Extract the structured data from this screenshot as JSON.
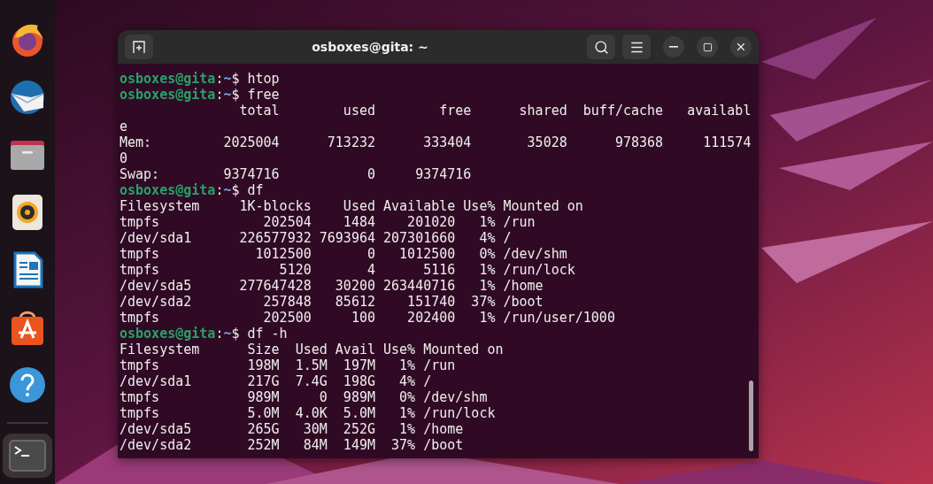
{
  "dock": {
    "items": [
      {
        "kind": "browser",
        "selected": false
      },
      {
        "kind": "mail",
        "selected": false
      },
      {
        "kind": "files",
        "selected": false
      },
      {
        "kind": "music",
        "selected": false
      },
      {
        "kind": "writer",
        "selected": false
      },
      {
        "kind": "store",
        "selected": false
      },
      {
        "kind": "help",
        "selected": false
      },
      {
        "kind": "separator"
      },
      {
        "kind": "terminal",
        "selected": true
      }
    ]
  },
  "window": {
    "title": "osboxes@gita: ~"
  },
  "terminal": {
    "lines": [
      {
        "kind": "prompt",
        "user": "osboxes@gita",
        "separator": ":",
        "path": "~",
        "symbol": "$ ",
        "command": "htop"
      },
      {
        "kind": "prompt",
        "user": "osboxes@gita",
        "separator": ":",
        "path": "~",
        "symbol": "$ ",
        "command": "free"
      },
      {
        "kind": "output",
        "text": "               total        used        free      shared  buff/cache   availabl"
      },
      {
        "kind": "output",
        "text": "e"
      },
      {
        "kind": "output",
        "text": "Mem:         2025004      713232      333404       35028      978368     111574"
      },
      {
        "kind": "output",
        "text": "0"
      },
      {
        "kind": "output",
        "text": "Swap:        9374716           0     9374716"
      },
      {
        "kind": "prompt",
        "user": "osboxes@gita",
        "separator": ":",
        "path": "~",
        "symbol": "$ ",
        "command": "df"
      },
      {
        "kind": "output",
        "text": "Filesystem     1K-blocks    Used Available Use% Mounted on"
      },
      {
        "kind": "output",
        "text": "tmpfs             202504    1484    201020   1% /run"
      },
      {
        "kind": "output",
        "text": "/dev/sda1      226577932 7693964 207301660   4% /"
      },
      {
        "kind": "output",
        "text": "tmpfs            1012500       0   1012500   0% /dev/shm"
      },
      {
        "kind": "output",
        "text": "tmpfs               5120       4      5116   1% /run/lock"
      },
      {
        "kind": "output",
        "text": "/dev/sda5      277647428   30200 263440716   1% /home"
      },
      {
        "kind": "output",
        "text": "/dev/sda2         257848   85612    151740  37% /boot"
      },
      {
        "kind": "output",
        "text": "tmpfs             202500     100    202400   1% /run/user/1000"
      },
      {
        "kind": "prompt",
        "user": "osboxes@gita",
        "separator": ":",
        "path": "~",
        "symbol": "$ ",
        "command": "df -h"
      },
      {
        "kind": "output",
        "text": "Filesystem      Size  Used Avail Use% Mounted on"
      },
      {
        "kind": "output",
        "text": "tmpfs           198M  1.5M  197M   1% /run"
      },
      {
        "kind": "output",
        "text": "/dev/sda1       217G  7.4G  198G   4% /"
      },
      {
        "kind": "output",
        "text": "tmpfs           989M     0  989M   0% /dev/shm"
      },
      {
        "kind": "output",
        "text": "tmpfs           5.0M  4.0K  5.0M   1% /run/lock"
      },
      {
        "kind": "output",
        "text": "/dev/sda5       265G   30M  252G   1% /home"
      },
      {
        "kind": "output",
        "text": "/dev/sda2       252M   84M  149M  37% /boot"
      }
    ]
  }
}
